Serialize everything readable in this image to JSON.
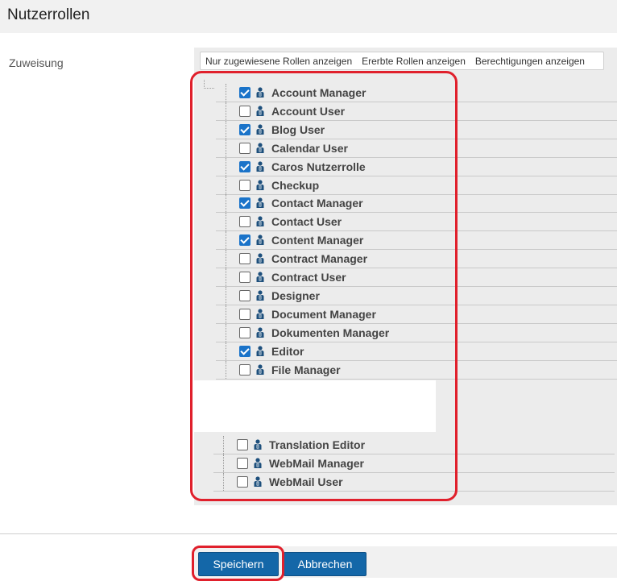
{
  "header": {
    "title": "Nutzerrollen"
  },
  "form": {
    "label": "Zuweisung"
  },
  "toolbar": {
    "buttons": [
      "Nur zugewiesene Rollen anzeigen",
      "Ererbte Rollen anzeigen",
      "Berechtigungen anzeigen"
    ]
  },
  "roles_top": [
    {
      "label": "Account Manager",
      "checked": true
    },
    {
      "label": "Account User",
      "checked": false
    },
    {
      "label": "Blog User",
      "checked": true
    },
    {
      "label": "Calendar User",
      "checked": false
    },
    {
      "label": "Caros Nutzerrolle",
      "checked": true
    },
    {
      "label": "Checkup",
      "checked": false
    },
    {
      "label": "Contact Manager",
      "checked": true
    },
    {
      "label": "Contact User",
      "checked": false
    },
    {
      "label": "Content Manager",
      "checked": true
    },
    {
      "label": "Contract Manager",
      "checked": false
    },
    {
      "label": "Contract User",
      "checked": false
    },
    {
      "label": "Designer",
      "checked": false
    },
    {
      "label": "Document Manager",
      "checked": false
    },
    {
      "label": "Dokumenten Manager",
      "checked": false
    },
    {
      "label": "Editor",
      "checked": true
    },
    {
      "label": "File Manager",
      "checked": false
    }
  ],
  "roles_bottom": [
    {
      "label": "Translation Editor",
      "checked": false
    },
    {
      "label": "WebMail Manager",
      "checked": false
    },
    {
      "label": "WebMail User",
      "checked": false
    }
  ],
  "actions": {
    "save": "Speichern",
    "cancel": "Abbrechen"
  },
  "colors": {
    "accent": "#1467a8",
    "checkbox": "#1a73c9",
    "highlight": "#e0202c"
  },
  "icons": {
    "role": "role-user-icon",
    "checkbox": "checkbox-icon"
  }
}
